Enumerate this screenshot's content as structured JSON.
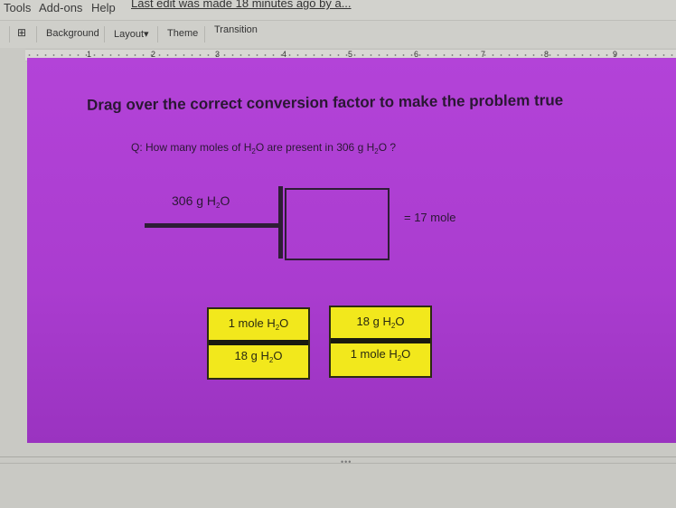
{
  "menubar": {
    "items": [
      "Tools",
      "Add-ons",
      "Help"
    ],
    "last_edit": "Last edit was made 18 minutes ago by a..."
  },
  "toolbar": {
    "buttons": [
      "Background",
      "Layout",
      "Theme",
      "Transition"
    ],
    "layout_caret": "▾",
    "comment_icon": "⊞"
  },
  "ruler": {
    "numbers": [
      "1",
      "2",
      "3",
      "4",
      "5",
      "6",
      "7",
      "8",
      "9"
    ]
  },
  "slide": {
    "title": "Drag over the correct conversion factor to make the problem true",
    "question": {
      "prefix": "Q:  How many moles of H",
      "sub1": "2",
      "mid": "O are present in 306 g H",
      "sub2": "2",
      "suffix": "O ?"
    },
    "given": {
      "pre": "306 g H",
      "sub": "2",
      "post": "O"
    },
    "result": "= 17 mole",
    "cards": [
      {
        "num_pre": "1 mole H",
        "num_sub": "2",
        "num_post": "O",
        "den_pre": "18 g H",
        "den_sub": "2",
        "den_post": "O"
      },
      {
        "num_pre": "18 g  H",
        "num_sub": "2",
        "num_post": "O",
        "den_pre": "1 mole H",
        "den_sub": "2",
        "den_post": "O"
      }
    ]
  },
  "footer": {
    "handle": "•••"
  }
}
